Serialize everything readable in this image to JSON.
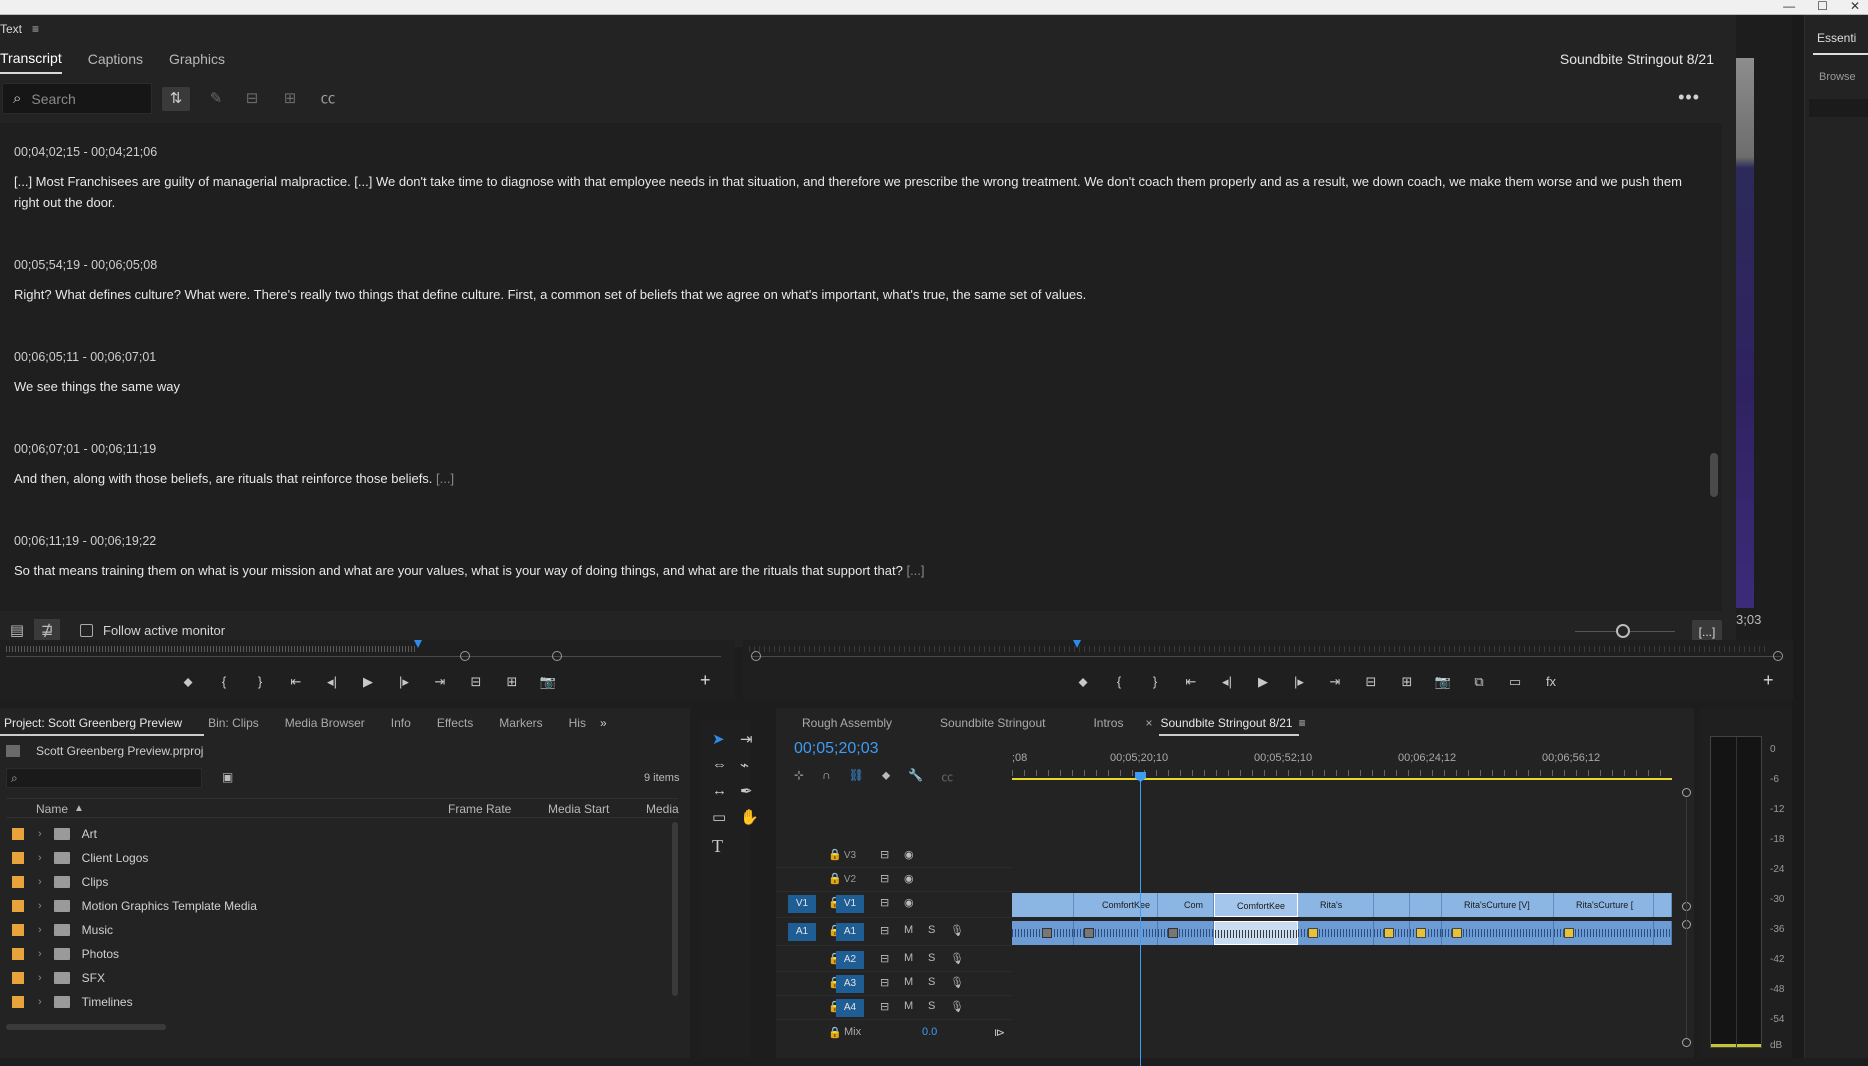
{
  "window": {
    "controls": [
      "—",
      "☐",
      "✕"
    ]
  },
  "text_panel": {
    "title": "Text",
    "menu_icon": "≡",
    "tabs": [
      {
        "label": "Transcript",
        "active": true
      },
      {
        "label": "Captions",
        "active": false
      },
      {
        "label": "Graphics",
        "active": false
      }
    ],
    "sequence_name": "Soundbite Stringout 8/21",
    "search_placeholder": "Search",
    "more_label": "•••",
    "entries": [
      {
        "timecode": "00;04;02;15 - 00;04;21;06",
        "text_pre": "[...] Most Franchisees are guilty of managerial malpractice. [...] We don't take time to diagnose with that employee needs in that situation, and therefore we prescribe the wrong treatment. We don't coach them properly and as a result, we down coach, we make them worse and we push them right out the door.",
        "trailing_gap": ""
      },
      {
        "timecode": "00;05;54;19 - 00;06;05;08",
        "text_pre": "Right? What defines culture? What were. There's really two things that define culture. First, a common set of beliefs that we agree on what's important, what's true, the same set of values.",
        "trailing_gap": ""
      },
      {
        "timecode": "00;06;05;11 - 00;06;07;01",
        "text_pre": "We see things the same way",
        "trailing_gap": ""
      },
      {
        "timecode": "00;06;07;01 - 00;06;11;19",
        "text_pre": "And then, along with those beliefs, are rituals that reinforce those beliefs.",
        "trailing_gap": "[...]"
      },
      {
        "timecode": "00;06;11;19 - 00;06;19;22",
        "text_pre": "So that means training them on what is your mission and what are your values, what is your way of doing things, and what are the rituals that support that?",
        "trailing_gap": "[...]"
      }
    ],
    "follow_label": "Follow active monitor",
    "caption_btn": "[...]"
  },
  "program": {
    "timecode_fragment": "3;03"
  },
  "right_panel": {
    "tab": "Essenti",
    "sub": "Browse"
  },
  "source_transport_icons": [
    "⬥",
    "{",
    "}",
    "⇤",
    "◂|",
    "▶",
    "|▸",
    "⇥",
    "⊟",
    "⊞",
    "📷"
  ],
  "program_transport_icons": [
    "⬥",
    "{",
    "}",
    "⇤",
    "◂|",
    "▶",
    "|▸",
    "⇥",
    "⊟",
    "⊞",
    "📷",
    "⧉",
    "▭",
    "fx"
  ],
  "project": {
    "tabs": [
      "Project: Scott Greenberg Preview",
      "Bin: Clips",
      "Media Browser",
      "Info",
      "Effects",
      "Markers",
      "His"
    ],
    "file": "Scott Greenberg Preview.prproj",
    "item_count": "9 items",
    "columns": [
      "Name",
      "Frame Rate",
      "Media Start",
      "Media"
    ],
    "items": [
      "Art",
      "Client Logos",
      "Clips",
      "Motion Graphics Template Media",
      "Music",
      "Photos",
      "SFX",
      "Timelines"
    ]
  },
  "timeline": {
    "tabs": [
      "Rough Assembly",
      "Soundbite Stringout",
      "Intros",
      "Soundbite Stringout 8/21"
    ],
    "timecode": "00;05;20;03",
    "ruler_ticks": [
      ";08",
      "00;05;20;10",
      "00;05;52;10",
      "00;06;24;12",
      "00;06;56;12"
    ],
    "video_tracks": [
      "V3",
      "V2",
      "V1"
    ],
    "audio_tracks": [
      "A1",
      "A2",
      "A3",
      "A4"
    ],
    "src_v": "V1",
    "src_a": "A1",
    "mix_label": "Mix",
    "mix_value": "0.0",
    "clips": [
      "ComfortKee",
      "Com",
      "ComfortKee",
      "Rita's",
      "Rita'sCurture [V]",
      "Rita'sCurture ["
    ],
    "track_m": "M",
    "track_s": "S"
  },
  "meter": {
    "labels": [
      "0",
      "-6",
      "-12",
      "-18",
      "-24",
      "-30",
      "-36",
      "-42",
      "-48",
      "-54",
      "dB"
    ]
  }
}
